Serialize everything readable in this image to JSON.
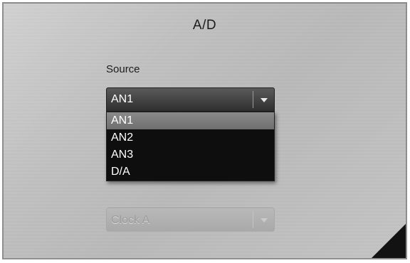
{
  "panel": {
    "title": "A/D"
  },
  "source": {
    "label": "Source",
    "selected_value": "AN1",
    "options": [
      "AN1",
      "AN2",
      "AN3",
      "D/A"
    ],
    "highlighted_index": 0,
    "arrow_icon": "chevron-down-icon"
  },
  "clock": {
    "selected_value": "Clock A",
    "disabled": true,
    "arrow_icon": "chevron-down-icon"
  },
  "colors": {
    "panel_background": "#c2c2c2",
    "dropdown_background": "#0e0e0e",
    "highlight": "#7d7d7d",
    "text_light": "#ffffff"
  }
}
